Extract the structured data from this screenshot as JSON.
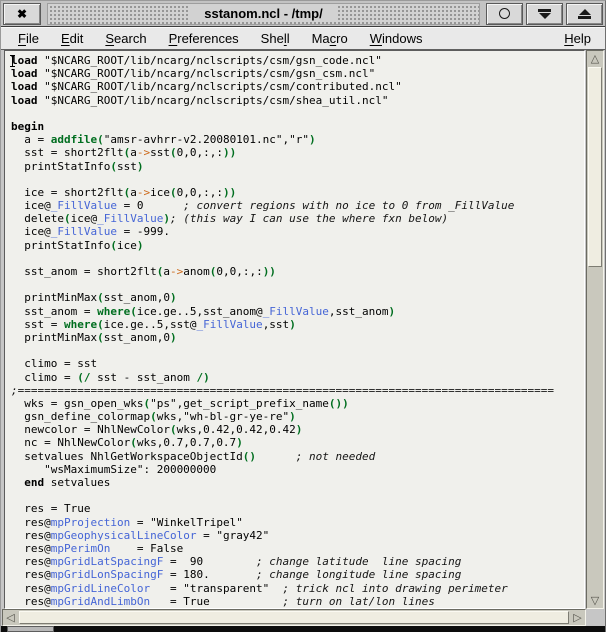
{
  "titlebar": {
    "title": "sstanom.ncl - /tmp/",
    "close_glyph": "✖"
  },
  "menu": {
    "items": [
      {
        "label": "File",
        "mnemonic": 0
      },
      {
        "label": "Edit",
        "mnemonic": 0
      },
      {
        "label": "Search",
        "mnemonic": 0
      },
      {
        "label": "Preferences",
        "mnemonic": 0
      },
      {
        "label": "Shell",
        "mnemonic": 3
      },
      {
        "label": "Macro",
        "mnemonic": 2
      },
      {
        "label": "Windows",
        "mnemonic": 0
      }
    ],
    "help": {
      "label": "Help",
      "mnemonic": 0
    }
  },
  "scrollbar": {
    "up_glyph": "△",
    "down_glyph": "▽",
    "left_glyph": "◁",
    "right_glyph": "▷"
  },
  "colors": {
    "function_green": "#006e1f",
    "attribute_blue": "#4565d6",
    "arrow_orange": "#cc6a1c",
    "comment": "#141414",
    "keyword": "#000000"
  },
  "code": {
    "lines": [
      [
        [
          "k",
          "load"
        ],
        [
          "",
          " \"$NCARG_ROOT/lib/ncarg/nclscripts/csm/gsn_code.ncl\""
        ]
      ],
      [
        [
          "k",
          "load"
        ],
        [
          "",
          " \"$NCARG_ROOT/lib/ncarg/nclscripts/csm/gsn_csm.ncl\""
        ]
      ],
      [
        [
          "k",
          "load"
        ],
        [
          "",
          " \"$NCARG_ROOT/lib/ncarg/nclscripts/csm/contributed.ncl\""
        ]
      ],
      [
        [
          "k",
          "load"
        ],
        [
          "",
          " \"$NCARG_ROOT/lib/ncarg/nclscripts/csm/shea_util.ncl\""
        ]
      ],
      [],
      [
        [
          "k",
          "begin"
        ]
      ],
      [
        [
          "",
          "  a = "
        ],
        [
          "g",
          "addfile("
        ],
        [
          "",
          "\"amsr-avhrr-v2.20080101.nc\",\"r\""
        ],
        [
          "g",
          ")"
        ]
      ],
      [
        [
          "",
          "  sst = short2flt"
        ],
        [
          "g",
          "("
        ],
        [
          "",
          "a"
        ],
        [
          "o",
          "->"
        ],
        [
          "",
          "sst"
        ],
        [
          "g",
          "("
        ],
        [
          "",
          "0,0,:,:"
        ],
        [
          "g",
          "))"
        ]
      ],
      [
        [
          "",
          "  printStatInfo"
        ],
        [
          "g",
          "("
        ],
        [
          "",
          "sst"
        ],
        [
          "g",
          ")"
        ]
      ],
      [],
      [
        [
          "",
          "  ice = short2flt"
        ],
        [
          "g",
          "("
        ],
        [
          "",
          "a"
        ],
        [
          "o",
          "->"
        ],
        [
          "",
          "ice"
        ],
        [
          "g",
          "("
        ],
        [
          "",
          "0,0,:,:"
        ],
        [
          "g",
          "))"
        ]
      ],
      [
        [
          "",
          "  ice@"
        ],
        [
          "a",
          "_FillValue"
        ],
        [
          "",
          " = 0      "
        ],
        [
          "c",
          "; convert regions with no ice to 0 from _FillValue"
        ]
      ],
      [
        [
          "",
          "  delete"
        ],
        [
          "g",
          "("
        ],
        [
          "",
          "ice@"
        ],
        [
          "a",
          "_FillValue"
        ],
        [
          "g",
          ")"
        ],
        [
          "c",
          "; (this way I can use the where fxn below)"
        ]
      ],
      [
        [
          "",
          "  ice@"
        ],
        [
          "a",
          "_FillValue"
        ],
        [
          "",
          " = -999."
        ]
      ],
      [
        [
          "",
          "  printStatInfo"
        ],
        [
          "g",
          "("
        ],
        [
          "",
          "ice"
        ],
        [
          "g",
          ")"
        ]
      ],
      [],
      [
        [
          "",
          "  sst_anom = short2flt"
        ],
        [
          "g",
          "("
        ],
        [
          "",
          "a"
        ],
        [
          "o",
          "->"
        ],
        [
          "",
          "anom"
        ],
        [
          "g",
          "("
        ],
        [
          "",
          "0,0,:,:"
        ],
        [
          "g",
          "))"
        ]
      ],
      [],
      [
        [
          "",
          "  printMinMax"
        ],
        [
          "g",
          "("
        ],
        [
          "",
          "sst_anom,0"
        ],
        [
          "g",
          ")"
        ]
      ],
      [
        [
          "",
          "  sst_anom = "
        ],
        [
          "g",
          "where("
        ],
        [
          "",
          "ice.ge..5,sst_anom@"
        ],
        [
          "a",
          "_FillValue"
        ],
        [
          "",
          ",sst_anom"
        ],
        [
          "g",
          ")"
        ]
      ],
      [
        [
          "",
          "  sst = "
        ],
        [
          "g",
          "where("
        ],
        [
          "",
          "ice.ge..5,sst@"
        ],
        [
          "a",
          "_FillValue"
        ],
        [
          "",
          ",sst"
        ],
        [
          "g",
          ")"
        ]
      ],
      [
        [
          "",
          "  printMinMax"
        ],
        [
          "g",
          "("
        ],
        [
          "",
          "sst_anom,0"
        ],
        [
          "g",
          ")"
        ]
      ],
      [],
      [
        [
          "",
          "  climo = sst"
        ]
      ],
      [
        [
          "",
          "  climo = "
        ],
        [
          "g",
          "(/"
        ],
        [
          "",
          " sst - sst_anom "
        ],
        [
          "g",
          "/)"
        ]
      ],
      [
        [
          "c",
          ";================================================================================="
        ]
      ],
      [
        [
          "",
          "  wks = gsn_open_wks"
        ],
        [
          "g",
          "("
        ],
        [
          "",
          "\"ps\",get_script_prefix_name"
        ],
        [
          "g",
          "())"
        ]
      ],
      [
        [
          "",
          "  gsn_define_colormap"
        ],
        [
          "g",
          "("
        ],
        [
          "",
          "wks,\"wh-bl-gr-ye-re\""
        ],
        [
          "g",
          ")"
        ]
      ],
      [
        [
          "",
          "  newcolor = NhlNewColor"
        ],
        [
          "g",
          "("
        ],
        [
          "",
          "wks,0.42,0.42,0.42"
        ],
        [
          "g",
          ")"
        ]
      ],
      [
        [
          "",
          "  nc = NhlNewColor"
        ],
        [
          "g",
          "("
        ],
        [
          "",
          "wks,0.7,0.7,0.7"
        ],
        [
          "g",
          ")"
        ]
      ],
      [
        [
          "",
          "  setvalues NhlGetWorkspaceObjectId"
        ],
        [
          "g",
          "()"
        ],
        [
          "",
          "      "
        ],
        [
          "c",
          "; not needed"
        ]
      ],
      [
        [
          "",
          "     \"wsMaximumSize\": 200000000"
        ]
      ],
      [
        [
          "",
          "  "
        ],
        [
          "k",
          "end"
        ],
        [
          "",
          " setvalues"
        ]
      ],
      [],
      [
        [
          "",
          "  res = True"
        ]
      ],
      [
        [
          "",
          "  res@"
        ],
        [
          "a",
          "mpProjection"
        ],
        [
          "",
          " = \"WinkelTripel\""
        ]
      ],
      [
        [
          "",
          "  res@"
        ],
        [
          "a",
          "mpGeophysicalLineColor"
        ],
        [
          "",
          " = \"gray42\""
        ]
      ],
      [
        [
          "",
          "  res@"
        ],
        [
          "a",
          "mpPerimOn"
        ],
        [
          "",
          "    = False"
        ]
      ],
      [
        [
          "",
          "  res@"
        ],
        [
          "a",
          "mpGridLatSpacingF"
        ],
        [
          "",
          " =  90        "
        ],
        [
          "c",
          "; change latitude  line spacing"
        ]
      ],
      [
        [
          "",
          "  res@"
        ],
        [
          "a",
          "mpGridLonSpacingF"
        ],
        [
          "",
          " = 180.       "
        ],
        [
          "c",
          "; change longitude line spacing"
        ]
      ],
      [
        [
          "",
          "  res@"
        ],
        [
          "a",
          "mpGridLineColor"
        ],
        [
          "",
          "   = \"transparent\"  "
        ],
        [
          "c",
          "; trick ncl into drawing perimeter"
        ]
      ],
      [
        [
          "",
          "  res@"
        ],
        [
          "a",
          "mpGridAndLimbOn"
        ],
        [
          "",
          "   = True           "
        ],
        [
          "c",
          "; turn on lat/lon lines"
        ]
      ]
    ]
  }
}
